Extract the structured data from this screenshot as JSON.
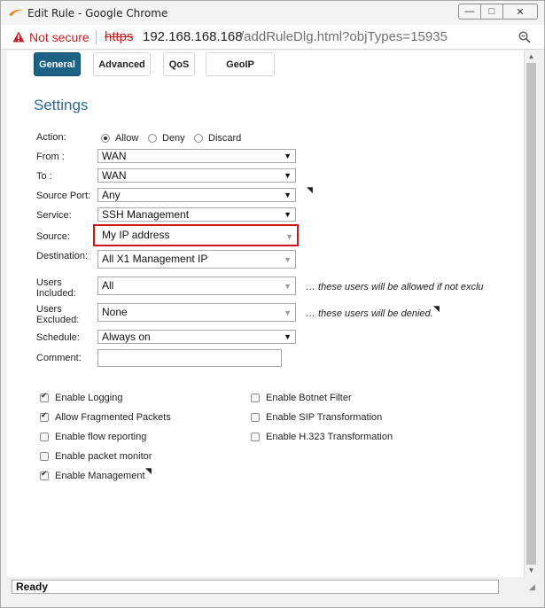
{
  "window": {
    "title": "Edit Rule - Google Chrome",
    "controls": {
      "minimize": "—",
      "maximize": "□",
      "close": "✕"
    }
  },
  "address_bar": {
    "security": "Not secure",
    "scheme": "https",
    "host": "192.168.168.168",
    "path": "/addRuleDlg.html?objTypes=15935"
  },
  "tabs": [
    {
      "label": "General",
      "active": true
    },
    {
      "label": "Advanced",
      "active": false
    },
    {
      "label": "QoS",
      "active": false
    },
    {
      "label": "GeoIP",
      "active": false
    }
  ],
  "settings": {
    "title": "Settings",
    "action": {
      "label": "Action:",
      "options": [
        "Allow",
        "Deny",
        "Discard"
      ],
      "selected": "Allow"
    },
    "from": {
      "label": "From :",
      "value": "WAN"
    },
    "to": {
      "label": "To :",
      "value": "WAN"
    },
    "source_port": {
      "label": "Source Port:",
      "value": "Any"
    },
    "service": {
      "label": "Service:",
      "value": "SSH Management"
    },
    "source": {
      "label": "Source:",
      "value": "My IP address"
    },
    "destination": {
      "label": "Destination:",
      "value": "All X1 Management IP"
    },
    "users_included": {
      "label_line1": "Users",
      "label_line2": "Included:",
      "value": "All",
      "note": "… these users will be allowed if not exclu"
    },
    "users_excluded": {
      "label_line1": "Users",
      "label_line2": "Excluded:",
      "value": "None",
      "note": "… these users will be denied."
    },
    "schedule": {
      "label": "Schedule:",
      "value": "Always on"
    },
    "comment": {
      "label": "Comment:",
      "value": ""
    }
  },
  "options_left": [
    {
      "label": "Enable Logging",
      "checked": true
    },
    {
      "label": "Allow Fragmented Packets",
      "checked": true
    },
    {
      "label": "Enable flow reporting",
      "checked": false
    },
    {
      "label": "Enable packet monitor",
      "checked": false
    },
    {
      "label": "Enable Management",
      "checked": true
    }
  ],
  "options_right": [
    {
      "label": "Enable Botnet Filter",
      "checked": false
    },
    {
      "label": "Enable SIP Transformation",
      "checked": false
    },
    {
      "label": "Enable H.323 Transformation",
      "checked": false
    }
  ],
  "status": {
    "text": "Ready"
  },
  "colors": {
    "active_tab": "#1c6287",
    "settings_title": "#2a6b93",
    "not_secure": "#c5221f",
    "highlight_border": "#d0131a"
  }
}
